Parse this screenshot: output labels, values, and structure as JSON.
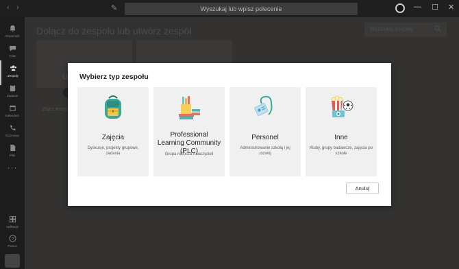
{
  "titlebar": {
    "search_placeholder": "Wyszukaj lub wpisz polecenie",
    "back_icon": "‹",
    "forward_icon": "›",
    "compose_icon": "✎",
    "minimize_icon": "—",
    "maximize_icon": "☐",
    "close_icon": "✕"
  },
  "rail": {
    "items": [
      {
        "label": "Aktywność",
        "icon": "bell-icon"
      },
      {
        "label": "Czat",
        "icon": "chat-icon"
      },
      {
        "label": "Zespoły",
        "icon": "teams-icon"
      },
      {
        "label": "Zadania",
        "icon": "assignments-icon"
      },
      {
        "label": "Kalendarz",
        "icon": "calendar-icon"
      },
      {
        "label": "Rozmowy",
        "icon": "phone-icon"
      },
      {
        "label": "Pliki",
        "icon": "files-icon"
      }
    ],
    "more": "···",
    "bottom": [
      {
        "label": "Aplikacje",
        "icon": "apps-icon"
      },
      {
        "label": "Pomoc",
        "icon": "help-icon"
      }
    ]
  },
  "main": {
    "title": "Dołącz do zespołu lub utwórz zespół",
    "search_placeholder": "Wyszukaj zespoły",
    "bg_fragment_1": "U",
    "bg_fragment_2": "Złącz wszyst"
  },
  "dialog": {
    "title": "Wybierz typ zespołu",
    "cards": [
      {
        "title": "Zajęcia",
        "desc": "Dyskusje, projekty grupowe, zadania",
        "icon": "backpack-icon"
      },
      {
        "title": "Professional Learning Community (PLC)",
        "desc": "Grupa robocza nauczycieli",
        "icon": "books-pencils-icon"
      },
      {
        "title": "Personel",
        "desc": "Administrowanie szkołą i jej rozwój",
        "icon": "id-badge-icon"
      },
      {
        "title": "Inne",
        "desc": "Kluby, grupy badawcze, zajęcia po szkole",
        "icon": "popcorn-ball-icon"
      }
    ],
    "cancel_label": "Anuluj"
  },
  "colors": {
    "dialog_bg": "#ffffff",
    "card_bg": "#f0f0f0",
    "overlay": "#333231",
    "rail_bg": "#1c1c1c"
  }
}
